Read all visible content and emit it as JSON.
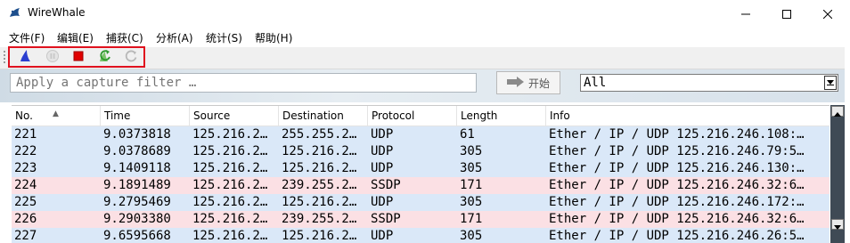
{
  "window": {
    "title": "WireWhale",
    "controls": {
      "minimize": "minimize",
      "maximize": "maximize",
      "close": "close"
    }
  },
  "menu": [
    "文件(F)",
    "编辑(E)",
    "捕获(C)",
    "分析(A)",
    "统计(S)",
    "帮助(H)"
  ],
  "toolbar": {
    "buttons": [
      {
        "name": "start-capture-icon",
        "icon": "shark-fin",
        "color": "#2b3fd0",
        "enabled": true
      },
      {
        "name": "pause-capture-icon",
        "icon": "pause-circle",
        "color": "#c8c8c8",
        "enabled": false
      },
      {
        "name": "stop-capture-icon",
        "icon": "red-square",
        "color": "#e00000",
        "enabled": true
      },
      {
        "name": "restart-capture-icon",
        "icon": "green-refresh",
        "color": "#2e9a2e",
        "enabled": true
      },
      {
        "name": "reload-icon",
        "icon": "gray-refresh",
        "color": "#b8b8b8",
        "enabled": false
      }
    ]
  },
  "filter": {
    "placeholder": "Apply a capture filter …",
    "start_label": "开始",
    "select_value": "All"
  },
  "table": {
    "columns": [
      "No.",
      "Time",
      "Source",
      "Destination",
      "Protocol",
      "Length",
      "Info"
    ],
    "rows": [
      {
        "no": "221",
        "time": "9.0373818",
        "source": "125.216.2…",
        "destination": "255.255.2…",
        "protocol": "UDP",
        "length": "61",
        "info": "Ether / IP / UDP 125.216.246.108:…",
        "color": "#dae8f8"
      },
      {
        "no": "222",
        "time": "9.0378689",
        "source": "125.216.2…",
        "destination": "125.216.2…",
        "protocol": "UDP",
        "length": "305",
        "info": "Ether / IP / UDP 125.216.246.79:5…",
        "color": "#dae8f8"
      },
      {
        "no": "223",
        "time": "9.1409118",
        "source": "125.216.2…",
        "destination": "125.216.2…",
        "protocol": "UDP",
        "length": "305",
        "info": "Ether / IP / UDP 125.216.246.130:…",
        "color": "#dae8f8"
      },
      {
        "no": "224",
        "time": "9.1891489",
        "source": "125.216.2…",
        "destination": "239.255.2…",
        "protocol": "SSDP",
        "length": "171",
        "info": "Ether / IP / UDP 125.216.246.32:6…",
        "color": "#fbe0e4"
      },
      {
        "no": "225",
        "time": "9.2795469",
        "source": "125.216.2…",
        "destination": "125.216.2…",
        "protocol": "UDP",
        "length": "305",
        "info": "Ether / IP / UDP 125.216.246.172:…",
        "color": "#dae8f8"
      },
      {
        "no": "226",
        "time": "9.2903380",
        "source": "125.216.2…",
        "destination": "239.255.2…",
        "protocol": "SSDP",
        "length": "171",
        "info": "Ether / IP / UDP 125.216.246.32:6…",
        "color": "#fbe0e4"
      },
      {
        "no": "227",
        "time": "9.6595668",
        "source": "125.216.2…",
        "destination": "125.216.2…",
        "protocol": "UDP",
        "length": "305",
        "info": "Ether / IP / UDP 125.216.246.26:5…",
        "color": "#dae8f8"
      }
    ]
  }
}
